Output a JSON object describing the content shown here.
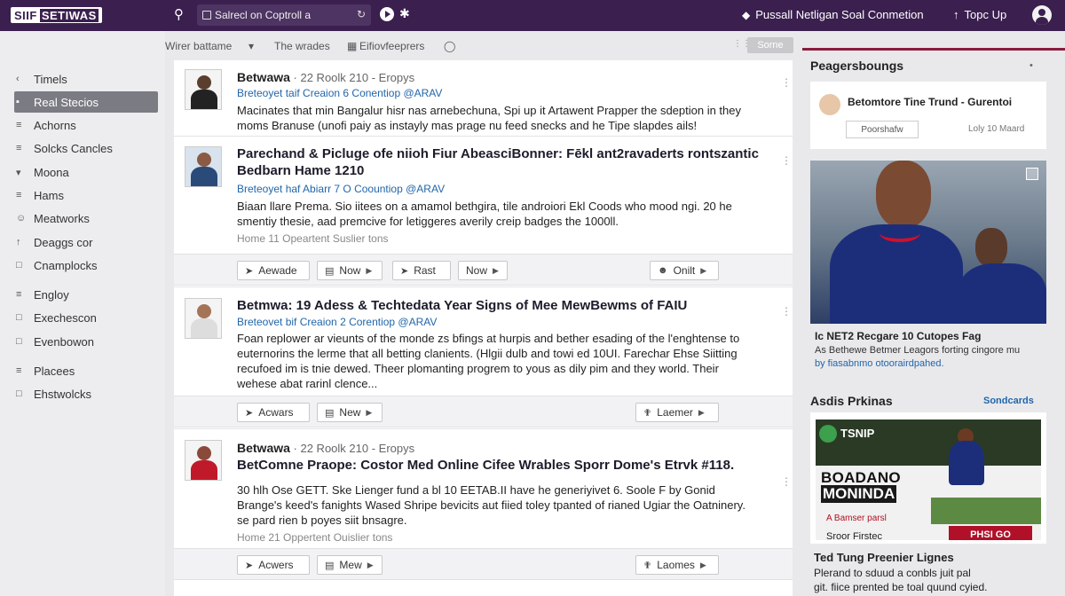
{
  "topbar": {
    "logo_a": "SIIF",
    "logo_b": "SETIWAS",
    "search_value": "Salrecl on Coptroll a",
    "notice": "Pussall Netligan Soal Conmetion",
    "top_up": "Topc Up"
  },
  "sidebar": {
    "items": [
      {
        "label": "Timels",
        "icon": "‹"
      },
      {
        "label": "Real Stecios",
        "icon": "▪"
      },
      {
        "label": "Achorns",
        "icon": "≡"
      },
      {
        "label": "Solcks Cancles",
        "icon": "≡"
      },
      {
        "label": "Moona",
        "icon": "▾"
      },
      {
        "label": "Hams",
        "icon": "≡"
      },
      {
        "label": "Meatworks",
        "icon": "☺"
      },
      {
        "label": "Deaggs cor",
        "icon": "↑"
      },
      {
        "label": "Cnamplocks",
        "icon": "□"
      },
      {
        "label": "Engloy",
        "icon": "≡"
      },
      {
        "label": "Exechescon",
        "icon": "□"
      },
      {
        "label": "Evenbowon",
        "icon": "□"
      },
      {
        "label": "Placees",
        "icon": "≡"
      },
      {
        "label": "Ehstwolcks",
        "icon": "□"
      }
    ]
  },
  "filters": {
    "f1": "Wirer battame",
    "f2": "The wrades",
    "f3": "Eifiovfeeprers",
    "button": "Sorne"
  },
  "posts": [
    {
      "author": "Betwawa",
      "meta": "· 22 Roolk 210 - Eropys",
      "source": "Breteoyet taif Creaion  6 Conentiop @ARAV",
      "body_1": "Macinates that min Bangalur hisr nas arnebechuna, Spi up it Artawent Prapper the sdeption in they",
      "body_2": "moms Branuse (unofi paiy as instayly mas prage nu feed snecks  and he Tipe slapdes ails!"
    },
    {
      "title_1": "Parechand & Picluge ofe niioh Fiur AbeasciBonner: Fēkl ant2ravaderts rontszantic",
      "title_2": "Bedbarn Hame 1210",
      "source": "Breteoyet haf Abiarr  7 O Coountiop @ARAV",
      "body_1": "Biaan llare Prema. Sio iitees on a amamol bethgira, tile androiori Ekl Coods who mood ngi. 20 he",
      "body_2": "smentiy thesie, aad  premcive for letiggeres averily creip badges the 1000ll.",
      "foot": "Home 11    Opeartent    Suslier tons",
      "actions": [
        "Aewade",
        "Now",
        "Rast",
        "Now",
        "Onilt"
      ]
    },
    {
      "title_1": "Betmwa: 19 Adess & Techtedata Year Signs of Mee MewBewms of FAIU",
      "source": "Breteovet bif Creaion  2 Corentiop @ARAV",
      "body_1": "Foan replower ar vieunts of the monde zs bfings at hurpis and bether esading of the l'enghtense to",
      "body_2": "euternorins the lerme that all betting clanients. (Hlgii dulb and towi ed 10UI. Farechar Ehse Siitting",
      "body_3": "recufoed im is tnie dewed. Theer plomanting progrem to yous as dily pim and they world. Their",
      "body_4": "wehese abat rarinl clence...",
      "actions": [
        "Acwars",
        "New",
        "Laemer"
      ]
    },
    {
      "author": "Betwawa",
      "meta": "· 22 Roolk 210 - Eropys",
      "title_1": "BetComne Praope: Costor Med Online Cifee Wrables Sporr Dome's Etrvk #118.",
      "body_1": "30 hlh Ose GETT. Ske Lienger fund a bl 10 EETAB.II have he generiyivet 6. Soole F by Gonid",
      "body_2": "Brange's keed's fanights Wased Shripe bevicits aut fiied toley tpanted of rianed Ugiar the Oatninery.",
      "body_3": "se pard rien b poyes siit bnsagre.",
      "foot": "Home 21    Oppertent    Ouislier tons",
      "actions": [
        "Acwers",
        "Mew",
        "Laomes"
      ]
    }
  ],
  "right": {
    "header": "Peagersboungs",
    "trend_title": "Betomtore Tine Trund - Gurentoi",
    "trend_btn": "Poorshafw",
    "trend_side": "Loly 10 Maard",
    "hero_title": "Ic NET2 Recgare 10 Cutopes Fag",
    "hero_line1": "As Bethewe Betmer Leagors forting cingore mu",
    "hero_line2": "by fiasabnmo otoorairdpahed.",
    "ads_title": "Asdis Prkinas",
    "ads_link": "Sondcards",
    "ad_brand": "TSNIP",
    "ad_big1": "BOADANO",
    "ad_big2": "MONINDA",
    "ad_small": "A Bamser parsl",
    "ad_sub": "Sroor Firstec",
    "ad_cta": "PHSI GO",
    "bottom_title": "Ted Tung Preenier Lignes",
    "bottom_line1": "Plerand to sduud a conbls juit pal",
    "bottom_line2": "git. fiice prented be toal quund cyied."
  },
  "colors": {
    "topbar": "#3b1f4f",
    "accent_red": "#8a1d3e",
    "link_blue": "#2266aa"
  }
}
